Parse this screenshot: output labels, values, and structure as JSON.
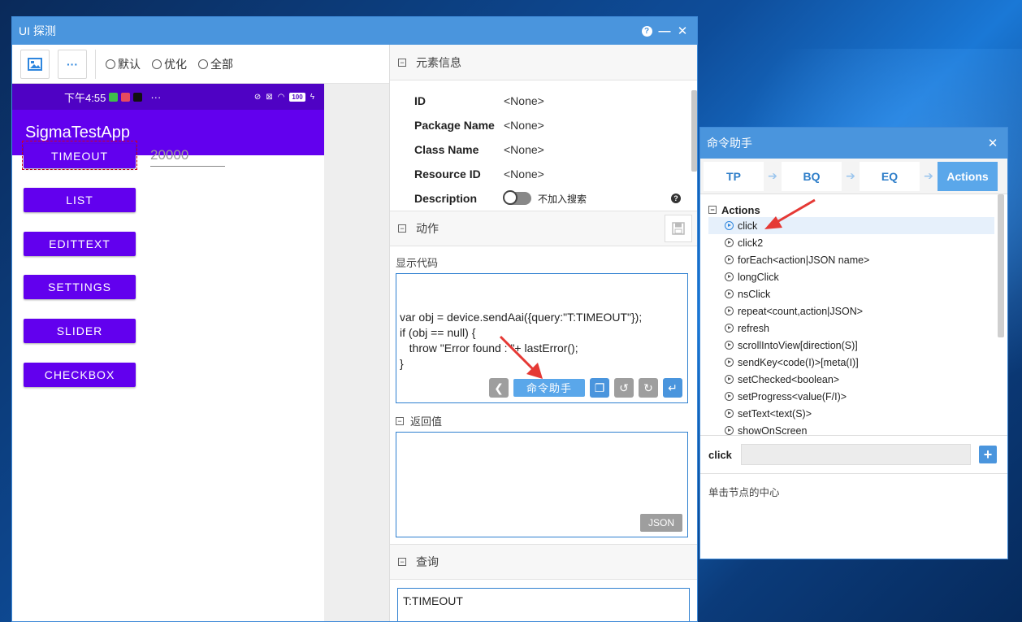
{
  "main_window": {
    "title": "UI 探测",
    "help": "?",
    "minimize": "—",
    "close": "✕"
  },
  "toolbar": {
    "more": "···",
    "radio_default": "默认",
    "radio_optimize": "优化",
    "radio_all": "全部"
  },
  "phone": {
    "time": "下午4:55",
    "more": "···",
    "battery": "100",
    "app_title": "SigmaTestApp",
    "buttons": [
      "TIMEOUT",
      "LIST",
      "EDITTEXT",
      "SETTINGS",
      "SLIDER",
      "CHECKBOX"
    ],
    "edit_value": "20000"
  },
  "element_info": {
    "header": "元素信息",
    "rows": [
      {
        "key": "ID",
        "value": "<None>"
      },
      {
        "key": "Package Name",
        "value": "<None>"
      },
      {
        "key": "Class Name",
        "value": "<None>"
      },
      {
        "key": "Resource ID",
        "value": "<None>"
      }
    ],
    "description_key": "Description",
    "toggle_label": "不加入搜索",
    "help": "?"
  },
  "actions": {
    "header": "动作",
    "show_code_label": "显示代码",
    "code": "var obj = device.sendAai({query:\"T:TIMEOUT\"});\nif (obj == null) {\n   throw \"Error found : \"+ lastError();\n}",
    "command_helper_button": "命令助手",
    "return_label": "返回值",
    "json_button": "JSON"
  },
  "query": {
    "header": "查询",
    "value": "T:TIMEOUT"
  },
  "helper_window": {
    "title": "命令助手",
    "close": "✕",
    "steps": [
      "TP",
      "BQ",
      "EQ",
      "Actions"
    ],
    "active_step": "Actions",
    "tree_root": "Actions",
    "items": [
      "click",
      "click2",
      "forEach<action|JSON name>",
      "longClick",
      "nsClick",
      "repeat<count,action|JSON>",
      "refresh",
      "scrollIntoView[direction(S)]",
      "sendKey<code(I)>[meta(I)]",
      "setChecked<boolean>",
      "setProgress<value(F/I)>",
      "setText<text(S)>",
      "showOnScreen"
    ],
    "selected_item": "click",
    "param_label": "click",
    "param_value": "",
    "add_button": "+",
    "description": "单击节点的中心"
  },
  "colors": {
    "titlebar": "#4a95dd",
    "app_purple": "#6200ee",
    "status_purple": "#4f02c4",
    "accent_blue": "#5aa7ea",
    "arrow_red": "#e53935"
  },
  "icons": {
    "screenshot": "image-icon",
    "more": "more-icon",
    "save": "save-icon",
    "back": "chevron-left-icon",
    "copy": "copy-icon",
    "undo": "undo-icon",
    "redo": "redo-icon",
    "enter": "enter-icon",
    "play": "play-circle-icon"
  }
}
